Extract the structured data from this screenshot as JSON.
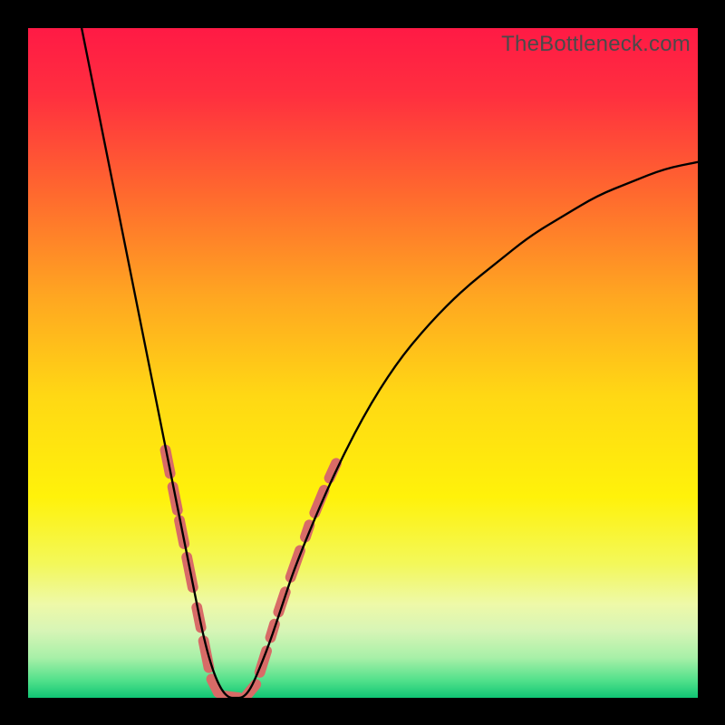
{
  "watermark": "TheBottleneck.com",
  "chart_data": {
    "type": "line",
    "title": "",
    "xlabel": "",
    "ylabel": "",
    "xlim": [
      0,
      100
    ],
    "ylim": [
      0,
      100
    ],
    "background_gradient": {
      "direction": "vertical",
      "stops": [
        {
          "pos": 0.0,
          "color": "#ff1a45"
        },
        {
          "pos": 0.1,
          "color": "#ff2f3f"
        },
        {
          "pos": 0.25,
          "color": "#ff6a2e"
        },
        {
          "pos": 0.4,
          "color": "#ffa621"
        },
        {
          "pos": 0.55,
          "color": "#ffd814"
        },
        {
          "pos": 0.7,
          "color": "#fff20a"
        },
        {
          "pos": 0.8,
          "color": "#f3f85a"
        },
        {
          "pos": 0.86,
          "color": "#eef9a8"
        },
        {
          "pos": 0.9,
          "color": "#d7f5b6"
        },
        {
          "pos": 0.94,
          "color": "#a8f0a8"
        },
        {
          "pos": 0.975,
          "color": "#4fe08a"
        },
        {
          "pos": 1.0,
          "color": "#10c574"
        }
      ]
    },
    "series": [
      {
        "name": "bottleneck-curve",
        "stroke": "#000000",
        "x": [
          8,
          10,
          12,
          14,
          16,
          18,
          20,
          22,
          23,
          24,
          25,
          26,
          27,
          28,
          29,
          30,
          31,
          32,
          33,
          34,
          36,
          38,
          40,
          45,
          50,
          55,
          60,
          65,
          70,
          75,
          80,
          85,
          90,
          95,
          100
        ],
        "y": [
          100,
          90,
          80,
          70,
          60,
          50,
          40,
          30,
          25,
          20,
          15,
          10,
          6,
          3,
          1,
          0,
          0,
          0,
          1,
          3,
          8,
          14,
          20,
          32,
          42,
          50,
          56,
          61,
          65,
          69,
          72,
          75,
          77,
          79,
          80
        ]
      }
    ],
    "markers": {
      "name": "left-dashes",
      "shape": "rounded-segment",
      "color": "#d86b67",
      "segments": [
        {
          "x1": 20.5,
          "y1": 37.0,
          "x2": 21.2,
          "y2": 33.5
        },
        {
          "x1": 21.6,
          "y1": 31.5,
          "x2": 22.3,
          "y2": 28.0
        },
        {
          "x1": 22.6,
          "y1": 26.5,
          "x2": 23.3,
          "y2": 23.0
        },
        {
          "x1": 23.7,
          "y1": 21.0,
          "x2": 24.6,
          "y2": 16.5
        },
        {
          "x1": 25.2,
          "y1": 13.5,
          "x2": 25.8,
          "y2": 10.5
        },
        {
          "x1": 26.2,
          "y1": 8.5,
          "x2": 27.0,
          "y2": 4.5
        },
        {
          "x1": 27.4,
          "y1": 2.8,
          "x2": 28.4,
          "y2": 0.8
        },
        {
          "x1": 29.0,
          "y1": 0.3,
          "x2": 31.5,
          "y2": 0.0
        },
        {
          "x1": 32.5,
          "y1": 0.2,
          "x2": 34.0,
          "y2": 2.0
        },
        {
          "x1": 34.6,
          "y1": 3.8,
          "x2": 35.6,
          "y2": 7.0
        },
        {
          "x1": 36.2,
          "y1": 9.0,
          "x2": 36.8,
          "y2": 11.0
        },
        {
          "x1": 37.4,
          "y1": 12.8,
          "x2": 38.4,
          "y2": 15.8
        },
        {
          "x1": 39.2,
          "y1": 18.0,
          "x2": 40.6,
          "y2": 22.0
        },
        {
          "x1": 41.4,
          "y1": 24.0,
          "x2": 42.0,
          "y2": 25.8
        },
        {
          "x1": 42.8,
          "y1": 27.6,
          "x2": 44.2,
          "y2": 31.0
        },
        {
          "x1": 45.0,
          "y1": 32.8,
          "x2": 46.0,
          "y2": 35.0
        }
      ]
    }
  }
}
